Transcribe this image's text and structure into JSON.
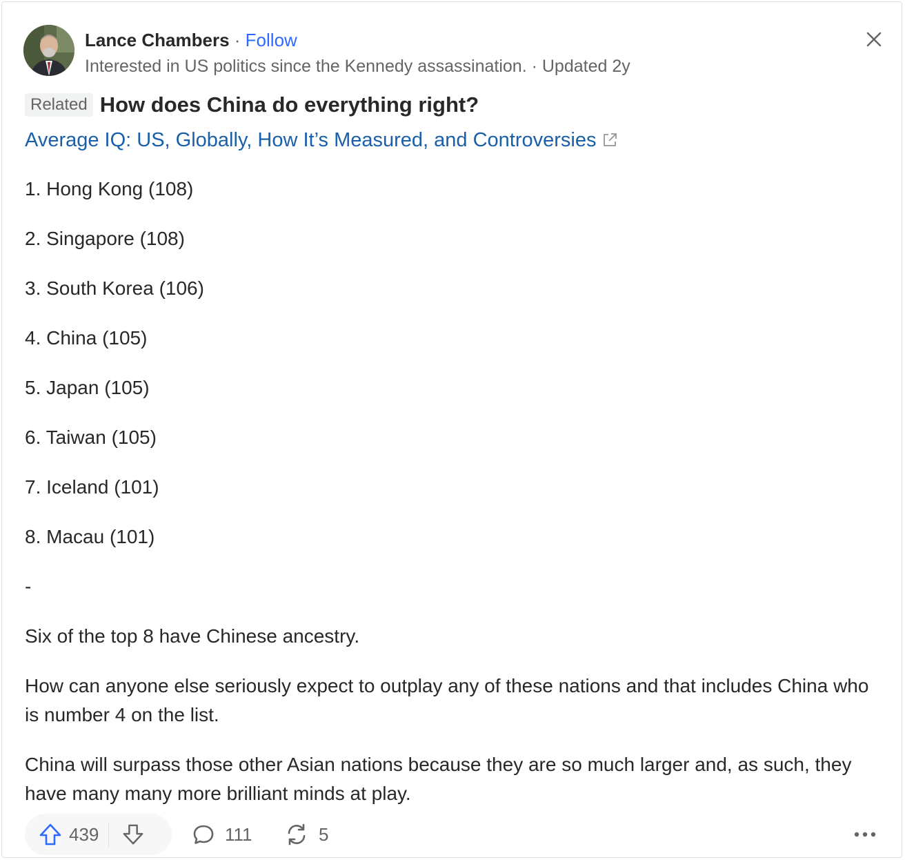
{
  "author": {
    "name": "Lance Chambers",
    "separator": "·",
    "follow_label": "Follow",
    "credential": "Interested in US politics since the Kennedy assassination.",
    "updated": "· Updated 2y"
  },
  "question": {
    "badge": "Related",
    "title": "How does China do everything right?"
  },
  "source_link": {
    "text": "Average IQ: US, Globally, How It’s Measured, and Controversies"
  },
  "list_items": [
    "1. Hong Kong (108)",
    "2. Singapore (108)",
    "3. South Korea (106)",
    "4. China (105)",
    "5. Japan (105)",
    "6. Taiwan (105)",
    "7. Iceland (101)",
    "8. Macau (101)"
  ],
  "dash": "-",
  "paragraphs": [
    "Six of the top 8 have Chinese ancestry.",
    "How can anyone else seriously expect to outplay any of these nations and that includes China who is number 4 on the list.",
    "China will surpass those other Asian nations because they are so much larger and, as such, they have many many more brilliant minds at play."
  ],
  "actions": {
    "upvotes": "439",
    "comments": "111",
    "shares": "5"
  },
  "icons": {
    "close": "close-icon",
    "external": "external-link-icon",
    "upvote": "upvote-arrow-icon",
    "downvote": "downvote-arrow-icon",
    "comment": "comment-bubble-icon",
    "share": "share-cycle-icon",
    "more": "more-dots-icon"
  },
  "colors": {
    "follow": "#2e69ff",
    "link": "#195faa",
    "upvote": "#2e69ff",
    "muted": "#636466"
  }
}
